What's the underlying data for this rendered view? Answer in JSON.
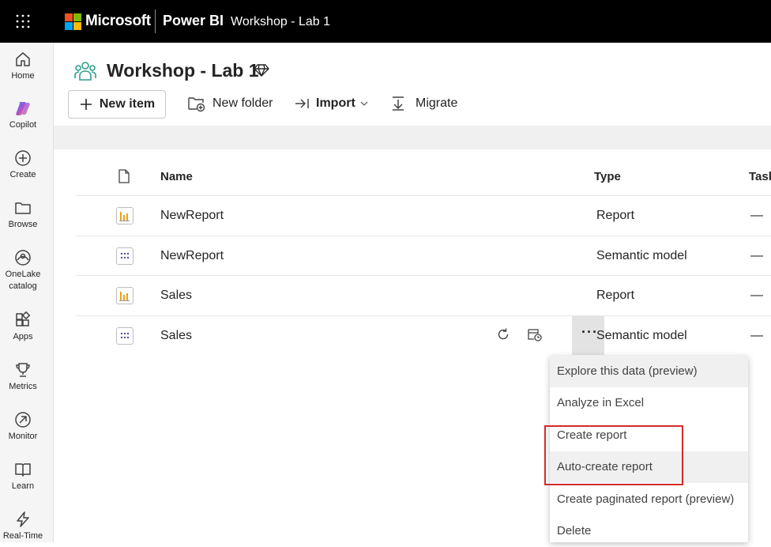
{
  "topbar": {
    "brand": "Microsoft",
    "product": "Power BI",
    "workspace": "Workshop - Lab 1"
  },
  "leftnav": {
    "items": [
      {
        "label": "Home",
        "icon": "home-icon"
      },
      {
        "label": "Copilot",
        "icon": "copilot-icon"
      },
      {
        "label": "Create",
        "icon": "create-icon"
      },
      {
        "label": "Browse",
        "icon": "folder-icon"
      },
      {
        "label": "OneLake catalog",
        "icon": "onelake-icon"
      },
      {
        "label": "Apps",
        "icon": "apps-icon"
      },
      {
        "label": "Metrics",
        "icon": "trophy-icon"
      },
      {
        "label": "Monitor",
        "icon": "monitor-icon"
      },
      {
        "label": "Learn",
        "icon": "book-icon"
      },
      {
        "label": "Real-Time",
        "icon": "lightning-icon"
      }
    ]
  },
  "header": {
    "title": "Workshop - Lab 1"
  },
  "toolbar": {
    "new_item": "New item",
    "new_folder": "New folder",
    "import": "Import",
    "migrate": "Migrate"
  },
  "table": {
    "columns": {
      "name": "Name",
      "type": "Type",
      "task": "Task"
    },
    "rows": [
      {
        "name": "NewReport",
        "type": "Report",
        "task": "—",
        "icon": "report-icon"
      },
      {
        "name": "NewReport",
        "type": "Semantic model",
        "task": "—",
        "icon": "semantic-model-icon"
      },
      {
        "name": "Sales",
        "type": "Report",
        "task": "—",
        "icon": "report-icon"
      },
      {
        "name": "Sales",
        "type": "Semantic model",
        "task": "—",
        "icon": "semantic-model-icon"
      }
    ],
    "more_label": "···"
  },
  "context_menu": {
    "items": [
      "Explore this data (preview)",
      "Analyze in Excel",
      "Create report",
      "Auto-create report",
      "Create paginated report (preview)",
      "Delete"
    ]
  },
  "colors": {
    "highlight": "#d42b2b",
    "topbar": "#000000",
    "report_icon": "#e8a317",
    "semantic_icon": "#5b4fa8"
  }
}
